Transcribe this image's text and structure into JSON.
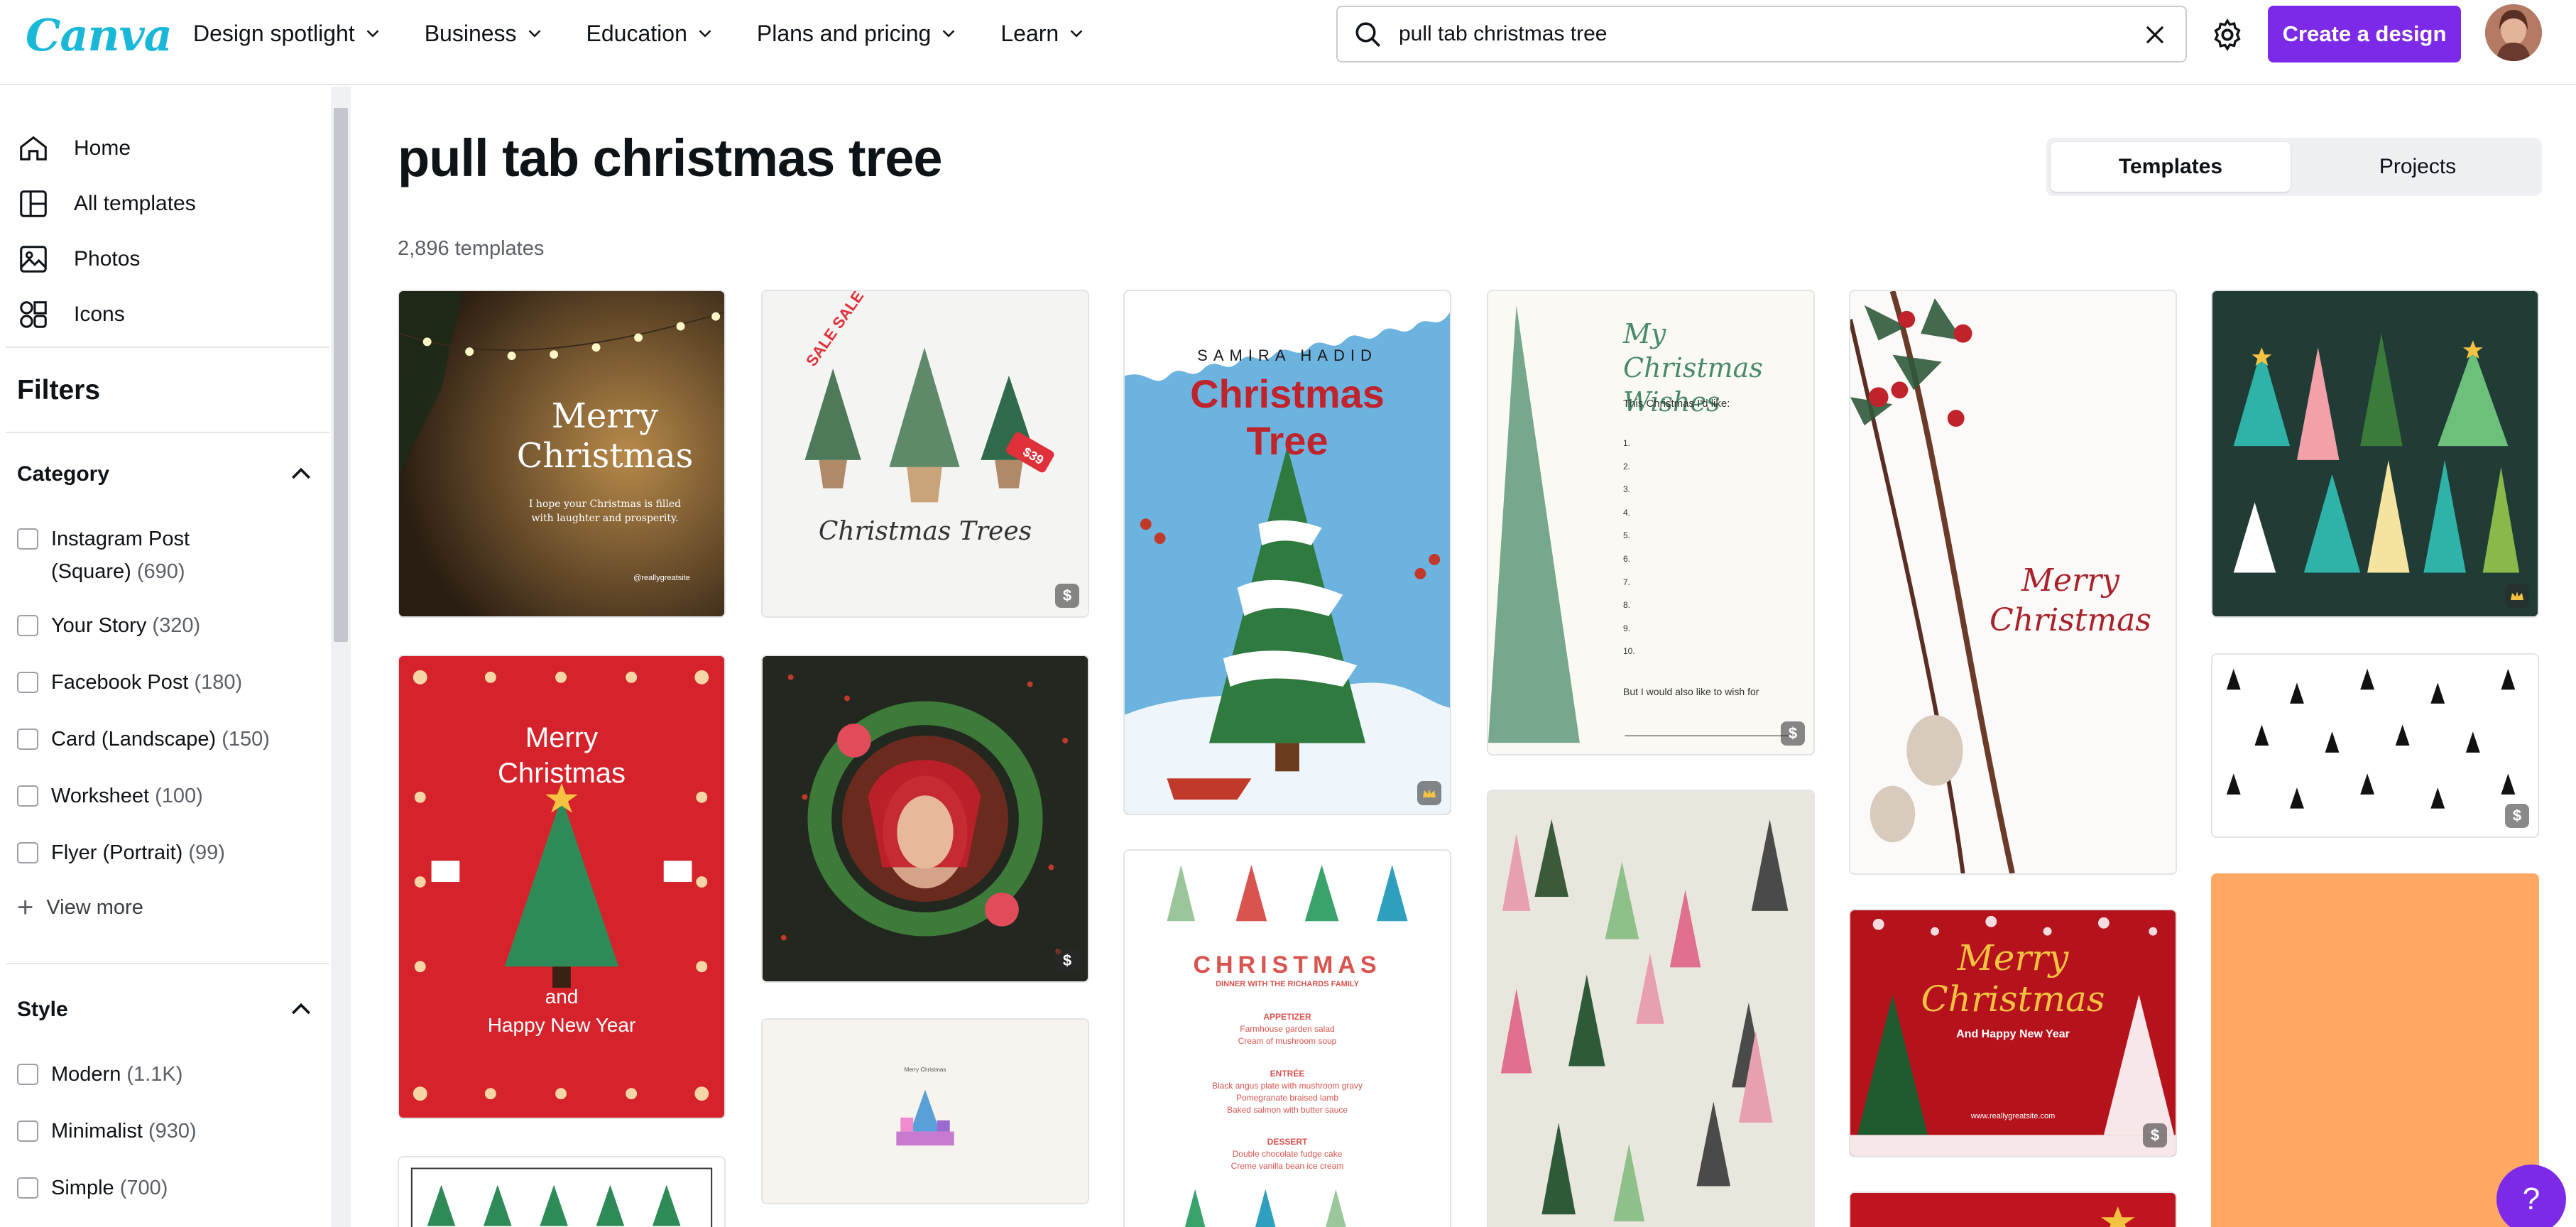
{
  "brand": {
    "logo_text": "Canva",
    "logo_color": "#19b8d8",
    "accent": "#7d2ae8"
  },
  "nav": {
    "links": [
      "Design spotlight",
      "Business",
      "Education",
      "Plans and pricing",
      "Learn"
    ]
  },
  "search": {
    "value": "pull tab christmas tree",
    "icon": "search-icon",
    "clear_icon": "close-icon"
  },
  "header_actions": {
    "settings_icon": "gear-icon",
    "create_label": "Create a design"
  },
  "sidebar": {
    "nav": [
      {
        "label": "Home",
        "icon": "home-icon"
      },
      {
        "label": "All templates",
        "icon": "templates-icon"
      },
      {
        "label": "Photos",
        "icon": "photos-icon"
      },
      {
        "label": "Icons",
        "icon": "shapes-icon"
      }
    ],
    "filters_title": "Filters",
    "category": {
      "title": "Category",
      "items": [
        {
          "label": "Instagram Post",
          "label2": "(Square)",
          "count": "(690)"
        },
        {
          "label": "Your Story",
          "count": "(320)"
        },
        {
          "label": "Facebook Post",
          "count": "(180)"
        },
        {
          "label": "Card (Landscape)",
          "count": "(150)"
        },
        {
          "label": "Worksheet",
          "count": "(100)"
        },
        {
          "label": "Flyer (Portrait)",
          "count": "(99)"
        }
      ],
      "view_more": "View more"
    },
    "style": {
      "title": "Style",
      "items": [
        {
          "label": "Modern",
          "count": "(1.1K)"
        },
        {
          "label": "Minimalist",
          "count": "(930)"
        },
        {
          "label": "Simple",
          "count": "(700)"
        }
      ]
    }
  },
  "main": {
    "title": "pull tab christmas tree",
    "count": "2,896 templates",
    "tabs": [
      "Templates",
      "Projects"
    ]
  },
  "templates": {
    "t1": {
      "line1": "Merry",
      "line2": "Christmas",
      "sub1": "I hope your Christmas is filled",
      "sub2": "with laughter and prosperity.",
      "handle": "@reallygreatsite"
    },
    "t2": {
      "sale": "SALE SALE SALE",
      "tag": "$39",
      "script": "Christmas Trees",
      "badge": "$"
    },
    "t3": {
      "name": "SAMIRA HADID",
      "line1": "Christmas",
      "line2": "Tree",
      "badge": "crown-icon"
    },
    "t4": {
      "title1": "My Christmas",
      "title2": "Wishes",
      "lead": "This Christmas I'd like:",
      "nums": [
        "1.",
        "2.",
        "3.",
        "4.",
        "5.",
        "6.",
        "7.",
        "8.",
        "9.",
        "10."
      ],
      "footer": "But I would also like to wish for",
      "badge": "$"
    },
    "t5": {
      "line1": "Merry",
      "line2": "Christmas"
    },
    "t6": {
      "badge": "crown-icon"
    },
    "t7": {
      "line1": "Merry",
      "line2": "Christmas",
      "line3": "and",
      "line4": "Happy New Year"
    },
    "t8": {
      "badge": "$"
    },
    "t9": {
      "label": "Merry Christmas"
    },
    "t10": {
      "heading": "CHRISTMAS",
      "sub": "DINNER WITH THE RICHARDS FAMILY",
      "sec1": "APPETIZER",
      "sec1a": "Farmhouse garden salad",
      "sec1b": "Cream of mushroom soup",
      "sec2": "ENTRÉE",
      "sec2a": "Black angus plate with mushroom gravy",
      "sec2b": "Pomegranate braised lamb",
      "sec2c": "Baked salmon with butter sauce",
      "sec3": "DESSERT",
      "sec3a": "Double chocolate fudge cake",
      "sec3b": "Creme vanilla bean ice cream"
    },
    "t12": {
      "line1": "Merry",
      "line2": "Christmas",
      "line3": "And Happy New Year",
      "url": "www.reallygreatsite.com",
      "badge": "$"
    },
    "t13": {
      "badge": "$"
    }
  },
  "help": {
    "label": "?"
  }
}
